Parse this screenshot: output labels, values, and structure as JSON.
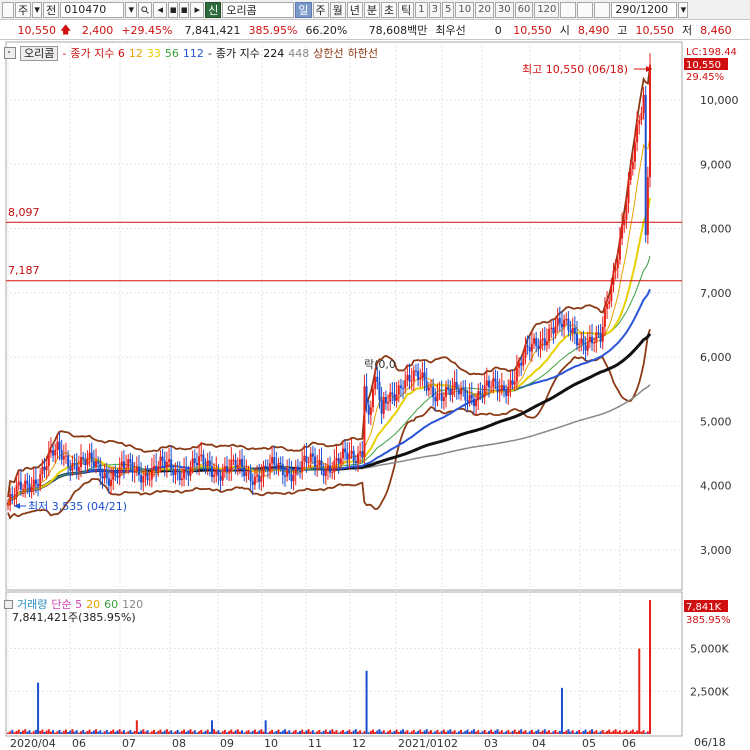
{
  "toolbar": {
    "menu_label": "주",
    "mode_label": "전",
    "code": "010470",
    "search_icon": "search-icon",
    "sound_icon": "sound-icon",
    "info_icon": "info-icon",
    "credit_label": "신",
    "stock_name": "오리콤",
    "periods": [
      "일",
      "주",
      "월",
      "년",
      "분",
      "초",
      "틱"
    ],
    "active_period": "일",
    "intervals": [
      "1",
      "3",
      "5",
      "10",
      "20",
      "30",
      "60",
      "120"
    ],
    "count_field": "290/1200",
    "dropdown_icon": "chevron-down-icon"
  },
  "quote": {
    "price": "10,550",
    "change": "2,400",
    "change_pct": "+29.45%",
    "volume": "7,841,421",
    "volume_ratio": "385.95%",
    "turnover": "66.20%",
    "amount": "78,608백만",
    "pref_label": "최우선",
    "pref_value": "0",
    "ask": "10,550",
    "open_label": "시",
    "open": "8,490",
    "high_label": "고",
    "high": "10,550",
    "low_label": "저",
    "low": "8,460"
  },
  "legend": {
    "name": "오리콤",
    "ma_label": "종가 지수 6",
    "ma_values": [
      "12",
      "33",
      "56",
      "112"
    ],
    "ma2_label": "종가 지수 224",
    "ma2_value": "448",
    "upper_label": "상한선",
    "lower_label": "하한선"
  },
  "volume_legend": {
    "title": "거래량",
    "ma_label": "단순 5",
    "ma_values": [
      "20",
      "60",
      "120"
    ],
    "value": "7,841,421주(385.95%)"
  },
  "price_axis": {
    "ticks": [
      "10,000",
      "9,000",
      "8,000",
      "7,000",
      "6,000",
      "5,000",
      "4,000",
      "3,000"
    ],
    "lc_label": "LC:198.44",
    "last_price": "10,550",
    "last_pct": "29.45%"
  },
  "volume_axis": {
    "ticks": [
      "5,000K",
      "2,500K"
    ],
    "last_volume": "7,841K",
    "last_pct": "385.95%"
  },
  "x_axis": {
    "ticks": [
      "2020/04",
      "06",
      "07",
      "08",
      "09",
      "10",
      "11",
      "12",
      "2021/01",
      "02",
      "03",
      "04",
      "05",
      "06"
    ],
    "end_date": "06/18"
  },
  "annotations": {
    "high_note": "최고 10,550 (06/18)",
    "low_note": "최저 3,535 (04/21)",
    "hline1": "8,097",
    "hline2": "7,187",
    "mid_note": "락(0,0"
  },
  "chart_data": {
    "type": "candlestick",
    "ylim": [
      2500,
      10700
    ],
    "dates": [
      "2020/04",
      "06",
      "07",
      "08",
      "09",
      "10",
      "11",
      "12",
      "2021/01",
      "02",
      "03",
      "04",
      "05",
      "06"
    ],
    "close": [
      3700,
      4500,
      4200,
      4250,
      4300,
      4200,
      4300,
      4400,
      5700,
      5400,
      5500,
      6500,
      6200,
      10550
    ],
    "high_mark": 10550,
    "low_mark": 3535,
    "horizontal_lines": [
      8097,
      7187
    ],
    "volume_ylim": [
      0,
      7841
    ],
    "volume_last": 7841,
    "colors": {
      "up": "#e8201a",
      "down": "#1a4fd0",
      "ma_black": "#111111",
      "ma_gray": "#888888",
      "band": "#8a3a14",
      "ma_blue": "#2a55d8",
      "ma_yellow": "#e8d000",
      "ma_green": "#3ca03c",
      "ma_pink": "#d040b0"
    }
  }
}
